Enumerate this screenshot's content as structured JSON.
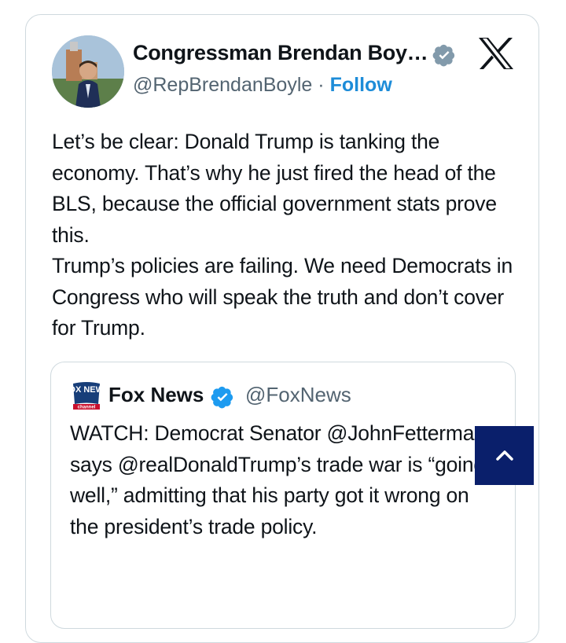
{
  "author": {
    "name": "Congressman Brendan Boy…",
    "handle": "@RepBrendanBoyle",
    "separator": "·",
    "follow_label": "Follow",
    "avatar_icon": "profile-photo"
  },
  "tweet": {
    "text": "Let’s be clear: Donald Trump is tanking the economy. That’s why he just fired the head of the BLS, because the official government stats prove this.\nTrump’s policies are failing. We need Democrats in Congress who will speak the truth and don’t cover for Trump."
  },
  "quoted": {
    "name": "Fox News",
    "handle": "@FoxNews",
    "logo_text": "FOX NEWS",
    "logo_subtext": "channel",
    "text": "WATCH: Democrat Senator @JohnFetterman says @realDonaldTrump’s trade war is “going well,” admitting that his party got it wrong on the president’s trade policy."
  },
  "colors": {
    "link": "#1d8cd8",
    "verified_gray": "#829aab",
    "verified_blue": "#1d9bf0",
    "scroll_button": "#0a1f6b"
  }
}
